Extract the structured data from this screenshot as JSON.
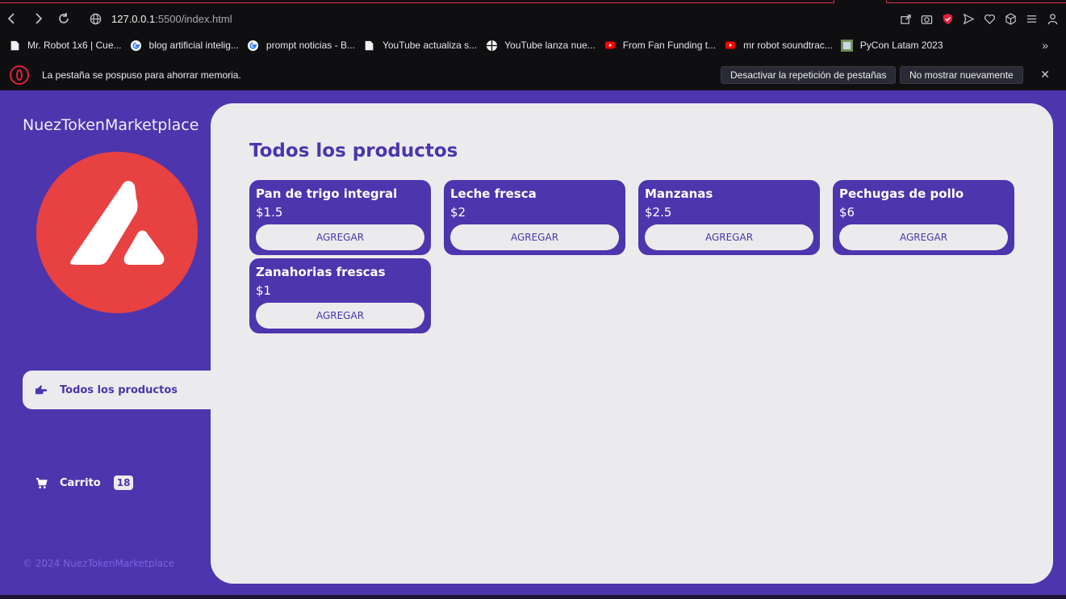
{
  "browser": {
    "url_host": "127.0.0.1",
    "url_path": ":5500/index.html",
    "bookmarks": [
      {
        "label": "Mr. Robot 1x6 | Cue...",
        "icon": "page-icon"
      },
      {
        "label": "blog artificial intelig...",
        "icon": "google-icon"
      },
      {
        "label": "prompt noticias - B...",
        "icon": "google-icon"
      },
      {
        "label": "YouTube actualiza s...",
        "icon": "page-icon"
      },
      {
        "label": "YouTube lanza nue...",
        "icon": "globe-icon"
      },
      {
        "label": "From Fan Funding t...",
        "icon": "youtube-icon"
      },
      {
        "label": "mr robot soundtrac...",
        "icon": "youtube-icon"
      },
      {
        "label": "PyCon Latam 2023",
        "icon": "image-icon"
      }
    ],
    "notice": {
      "text": "La pestaña se pospuso para ahorrar memoria.",
      "btn_disable": "Desactivar la repetición de pestañas",
      "btn_dont_show": "No mostrar nuevamente"
    }
  },
  "app": {
    "brand": "NuezTokenMarketplace",
    "nav": {
      "all_products": "Todos los productos",
      "cart": "Carrito",
      "cart_count": "18"
    },
    "footer": "© 2024 NuezTokenMarketplace",
    "main_title": "Todos los productos",
    "products": [
      {
        "name": "Pan de trigo integral",
        "price": "$1.5",
        "button": "AGREGAR"
      },
      {
        "name": "Leche fresca",
        "price": "$2",
        "button": "AGREGAR"
      },
      {
        "name": "Manzanas",
        "price": "$2.5",
        "button": "AGREGAR"
      },
      {
        "name": "Pechugas de pollo",
        "price": "$6",
        "button": "AGREGAR"
      },
      {
        "name": "Zanahorias frescas",
        "price": "$1",
        "button": "AGREGAR"
      }
    ]
  },
  "colors": {
    "primary": "#4d35ad",
    "surface": "#ebebed",
    "logo": "#e84142"
  }
}
